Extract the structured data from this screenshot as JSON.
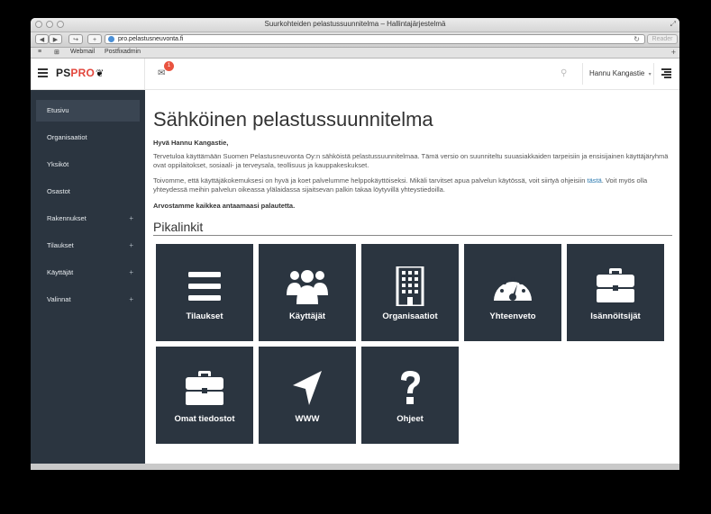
{
  "browser": {
    "title": "Suurkohteiden pelastussuunnitelma – Hallintajärjestelmä",
    "url": "pro.pelastusneuvonta.fi",
    "reader_label": "Reader",
    "bookmarks": [
      "Webmail",
      "Postfixadmin"
    ],
    "nav_back": "◀",
    "nav_forward": "▶",
    "share": "↪",
    "new_tab": "+",
    "reload": "↻",
    "bookmarks_icon": "≡",
    "topsites_icon": "⊞",
    "bookmark_add": "+"
  },
  "header": {
    "logo_ps": "PS",
    "logo_pro": "PRO",
    "logo_flame": "❦",
    "mail_icon": "✉",
    "mail_count": "1",
    "search_icon": "⚲",
    "user_name": "Hannu Kangastie",
    "user_caret": "▾"
  },
  "sidebar": {
    "items": [
      {
        "label": "Etusivu",
        "active": true,
        "plus": ""
      },
      {
        "label": "Organisaatiot",
        "active": false,
        "plus": ""
      },
      {
        "label": "Yksiköt",
        "active": false,
        "plus": ""
      },
      {
        "label": "Osastot",
        "active": false,
        "plus": ""
      },
      {
        "label": "Rakennukset",
        "active": false,
        "plus": "+"
      },
      {
        "label": "Tilaukset",
        "active": false,
        "plus": "+"
      },
      {
        "label": "Käyttäjät",
        "active": false,
        "plus": "+"
      },
      {
        "label": "Valinnat",
        "active": false,
        "plus": "+"
      }
    ]
  },
  "main": {
    "title": "Sähköinen pelastussuunnitelma",
    "greeting": "Hyvä Hannu Kangastie,",
    "paragraph1": "Tervetuloa käyttämään Suomen Pelastusneuvonta Oy:n sähköistä pelastussuunnitelmaa. Tämä versio on suunniteltu suuasiakkaiden tarpeisiin ja ensisijainen käyttäjäryhmä ovat oppilaitokset, sosiaali- ja terveysala, teollisuus ja kauppakeskukset.",
    "paragraph2_before": "Toivomme, että käyttäjäkokemuksesi on hyvä ja koet palvelumme helppokäyttöiseksi. Mikäli tarvitset apua palvelun käytössä, voit siirtyä ohjeisiin ",
    "paragraph2_link": "tästä",
    "paragraph2_after": ". Voit myös olla yhteydessä meihin palvelun oikeassa ylälaidassa sijaitsevan palkin takaa löytyvillä yhteystiedoilla.",
    "thanks": "Arvostamme kaikkea antaamaasi palautetta.",
    "quicklinks_title": "Pikalinkit",
    "tiles": [
      {
        "label": "Tilaukset",
        "icon": "list-icon"
      },
      {
        "label": "Käyttäjät",
        "icon": "users-icon"
      },
      {
        "label": "Organisaatiot",
        "icon": "building-icon"
      },
      {
        "label": "Yhteenveto",
        "icon": "dashboard-icon"
      },
      {
        "label": "Isännöitsijät",
        "icon": "briefcase-icon"
      },
      {
        "label": "Omat tiedostot",
        "icon": "briefcase-icon"
      },
      {
        "label": "WWW",
        "icon": "location-arrow-icon"
      },
      {
        "label": "Ohjeet",
        "icon": "question-icon"
      }
    ]
  },
  "colors": {
    "sidebar_bg": "#2b3540",
    "tile_bg": "#2b3540",
    "brand_red": "#e2463c",
    "badge": "#e9533f",
    "link": "#2a7ab0"
  }
}
